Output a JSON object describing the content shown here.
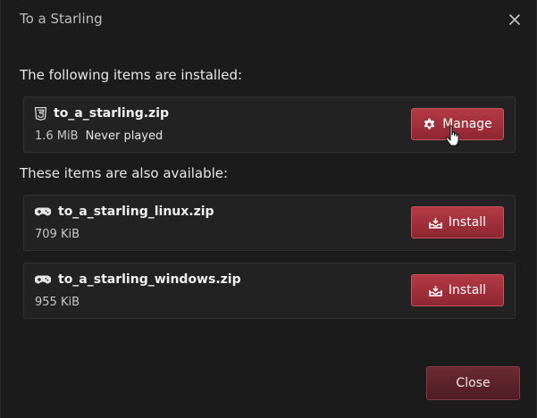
{
  "dialog": {
    "title": "To a Starling",
    "close_button_label": "Close"
  },
  "installed": {
    "heading": "The following items are installed:",
    "items": [
      {
        "name": "to_a_starling.zip",
        "size": "1.6 MiB",
        "status": "Never played",
        "icon": "html5-icon",
        "action_label": "Manage",
        "action_icon": "gear-icon"
      }
    ]
  },
  "available": {
    "heading": "These items are also available:",
    "items": [
      {
        "name": "to_a_starling_linux.zip",
        "size": "709 KiB",
        "icon": "gamepad-icon",
        "action_label": "Install",
        "action_icon": "download-tray-icon"
      },
      {
        "name": "to_a_starling_windows.zip",
        "size": "955 KiB",
        "icon": "gamepad-icon",
        "action_label": "Install",
        "action_icon": "download-tray-icon"
      }
    ]
  },
  "colors": {
    "background": "#1c1b1c",
    "card": "#232223",
    "accent_red": "#a3323d",
    "close_button": "#5c2329"
  }
}
